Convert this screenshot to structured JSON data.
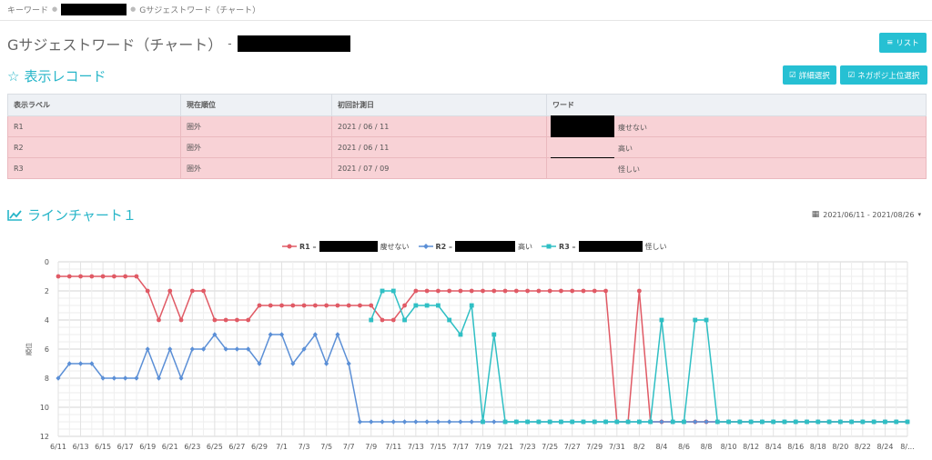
{
  "breadcrumb": {
    "item1": "キーワード",
    "item3": "Gサジェストワード（チャート）"
  },
  "page": {
    "title": "Gサジェストワード（チャート）",
    "title_dash": "-",
    "list_button": "リスト"
  },
  "records": {
    "section_title": "表示レコード",
    "detail_button": "詳細選択",
    "negaposi_button": "ネガポジ上位選択",
    "columns": [
      "表示ラベル",
      "現在順位",
      "初回計測日",
      "ワード"
    ],
    "rows": [
      {
        "label": "R1",
        "rank": "圏外",
        "date": "2021 / 06 / 11",
        "word": "痩せない"
      },
      {
        "label": "R2",
        "rank": "圏外",
        "date": "2021 / 06 / 11",
        "word": "高い"
      },
      {
        "label": "R3",
        "rank": "圏外",
        "date": "2021 / 07 / 09",
        "word": "怪しい"
      }
    ]
  },
  "line_chart": {
    "section_title": "ラインチャート１",
    "date_range": "2021/06/11 - 2021/08/26"
  },
  "chart_data": {
    "type": "line",
    "ylabel": "順位",
    "ylim": [
      0,
      12
    ],
    "y_inverted": true,
    "yticks": [
      0,
      2,
      4,
      6,
      8,
      10,
      12
    ],
    "xlabels": [
      "6/11",
      "6/13",
      "6/15",
      "6/17",
      "6/19",
      "6/21",
      "6/23",
      "6/25",
      "6/27",
      "6/29",
      "7/1",
      "7/3",
      "7/5",
      "7/7",
      "7/9",
      "7/11",
      "7/13",
      "7/15",
      "7/17",
      "7/19",
      "7/21",
      "7/23",
      "7/25",
      "7/27",
      "7/29",
      "7/31",
      "8/2",
      "8/4",
      "8/6",
      "8/8",
      "8/10",
      "8/12",
      "8/14",
      "8/16",
      "8/18",
      "8/20",
      "8/22",
      "8/24",
      "8/..."
    ],
    "x": [
      "6/11",
      "6/12",
      "6/13",
      "6/14",
      "6/15",
      "6/16",
      "6/17",
      "6/18",
      "6/19",
      "6/20",
      "6/21",
      "6/22",
      "6/23",
      "6/24",
      "6/25",
      "6/26",
      "6/27",
      "6/28",
      "6/29",
      "6/30",
      "7/1",
      "7/2",
      "7/3",
      "7/4",
      "7/5",
      "7/6",
      "7/7",
      "7/8",
      "7/9",
      "7/10",
      "7/11",
      "7/12",
      "7/13",
      "7/14",
      "7/15",
      "7/16",
      "7/17",
      "7/18",
      "7/19",
      "7/20",
      "7/21",
      "7/22",
      "7/23",
      "7/24",
      "7/25",
      "7/26",
      "7/27",
      "7/28",
      "7/29",
      "7/30",
      "7/31",
      "8/1",
      "8/2",
      "8/3",
      "8/4",
      "8/5",
      "8/6",
      "8/7",
      "8/8",
      "8/9",
      "8/10",
      "8/11",
      "8/12",
      "8/13",
      "8/14",
      "8/15",
      "8/16",
      "8/17",
      "8/18",
      "8/19",
      "8/20",
      "8/21",
      "8/22",
      "8/23",
      "8/24",
      "8/25",
      "8/26"
    ],
    "legend_position": "top",
    "series": [
      {
        "name": "R1 –",
        "word": "痩せない",
        "color": "#e05a65",
        "marker": "circle",
        "values": [
          1,
          1,
          1,
          1,
          1,
          1,
          1,
          1,
          2,
          4,
          2,
          4,
          2,
          2,
          4,
          4,
          4,
          4,
          3,
          3,
          3,
          3,
          3,
          3,
          3,
          3,
          3,
          3,
          3,
          4,
          4,
          3,
          2,
          2,
          2,
          2,
          2,
          2,
          2,
          2,
          2,
          2,
          2,
          2,
          2,
          2,
          2,
          2,
          2,
          2,
          11,
          11,
          2,
          11,
          11,
          11,
          11,
          11,
          11,
          11,
          11,
          11,
          11,
          11,
          11,
          11,
          11,
          11,
          11,
          11,
          11,
          11,
          11,
          11,
          11,
          11,
          11
        ]
      },
      {
        "name": "R2 –",
        "word": "高い",
        "color": "#5b8fd6",
        "marker": "diamond",
        "values": [
          8,
          7,
          7,
          7,
          8,
          8,
          8,
          8,
          6,
          8,
          6,
          8,
          6,
          6,
          5,
          6,
          6,
          6,
          7,
          5,
          5,
          7,
          6,
          5,
          7,
          5,
          7,
          11,
          11,
          11,
          11,
          11,
          11,
          11,
          11,
          11,
          11,
          11,
          11,
          11,
          11,
          11,
          11,
          11,
          11,
          11,
          11,
          11,
          11,
          11,
          11,
          11,
          11,
          11,
          11,
          11,
          11,
          11,
          11,
          11,
          11,
          11,
          11,
          11,
          11,
          11,
          11,
          11,
          11,
          11,
          11,
          11,
          11,
          11,
          11,
          11,
          11
        ]
      },
      {
        "name": "R3 –",
        "word": "怪しい",
        "color": "#2fbfc4",
        "marker": "square",
        "values": [
          null,
          null,
          null,
          null,
          null,
          null,
          null,
          null,
          null,
          null,
          null,
          null,
          null,
          null,
          null,
          null,
          null,
          null,
          null,
          null,
          null,
          null,
          null,
          null,
          null,
          null,
          null,
          null,
          4,
          2,
          2,
          4,
          3,
          3,
          3,
          4,
          5,
          3,
          11,
          5,
          11,
          11,
          11,
          11,
          11,
          11,
          11,
          11,
          11,
          11,
          11,
          11,
          11,
          11,
          4,
          11,
          11,
          4,
          4,
          11,
          11,
          11,
          11,
          11,
          11,
          11,
          11,
          11,
          11,
          11,
          11,
          11,
          11,
          11,
          11,
          11,
          11
        ]
      }
    ]
  },
  "icons": {
    "list": "list-icon",
    "star": "star-outline-icon",
    "check": "check-square-icon",
    "chart": "line-chart-icon",
    "calendar": "calendar-icon",
    "caret": "chevron-down-icon"
  },
  "colors": {
    "accent": "#26c0d3",
    "row_bg": "#f8d2d6"
  }
}
